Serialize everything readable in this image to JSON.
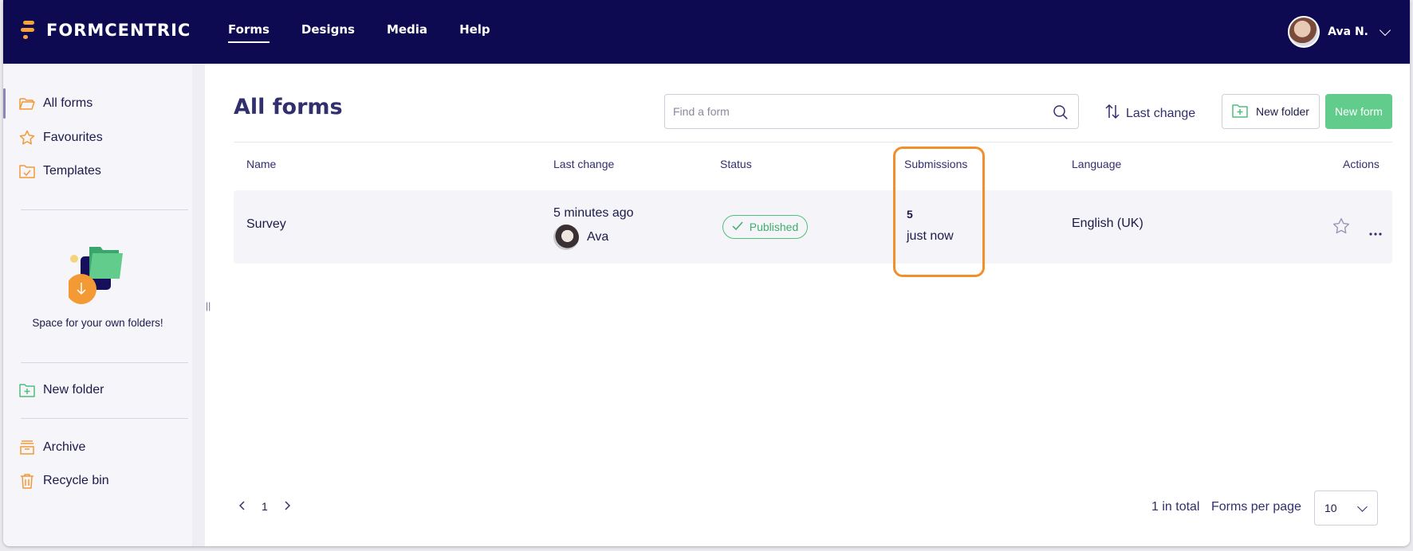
{
  "app": {
    "brand": "FORMCENTRIC"
  },
  "nav": {
    "items": [
      {
        "label": "Forms"
      },
      {
        "label": "Designs"
      },
      {
        "label": "Media"
      },
      {
        "label": "Help"
      }
    ]
  },
  "user": {
    "name": "Ava N."
  },
  "sidebar": {
    "items": [
      {
        "label": "All forms"
      },
      {
        "label": "Favourites"
      },
      {
        "label": "Templates"
      }
    ],
    "empty_text": "Space for your own folders!",
    "new_folder": "New folder",
    "archive": "Archive",
    "recycle_bin": "Recycle bin"
  },
  "main": {
    "title": "All forms",
    "search_placeholder": "Find a form",
    "sort_label": "Last change",
    "new_folder_button": "New folder",
    "new_form_button": "New form",
    "columns": [
      "Name",
      "Last change",
      "Status",
      "Submissions",
      "Language",
      "Actions"
    ],
    "rows": [
      {
        "name": "Survey",
        "last_change": "5 minutes ago",
        "changed_by": "Ava",
        "status": "Published",
        "submissions_count": "5",
        "submissions_time": "just now",
        "language": "English (UK)"
      }
    ]
  },
  "footer": {
    "page": "1",
    "total": "1 in total",
    "per_page_label": "Forms per page",
    "per_page_value": "10"
  },
  "colors": {
    "topbar": "#0d0a52",
    "accent_green": "#62cc8c",
    "highlight": "#f08f2c",
    "brand_orange": "#f7a335"
  }
}
